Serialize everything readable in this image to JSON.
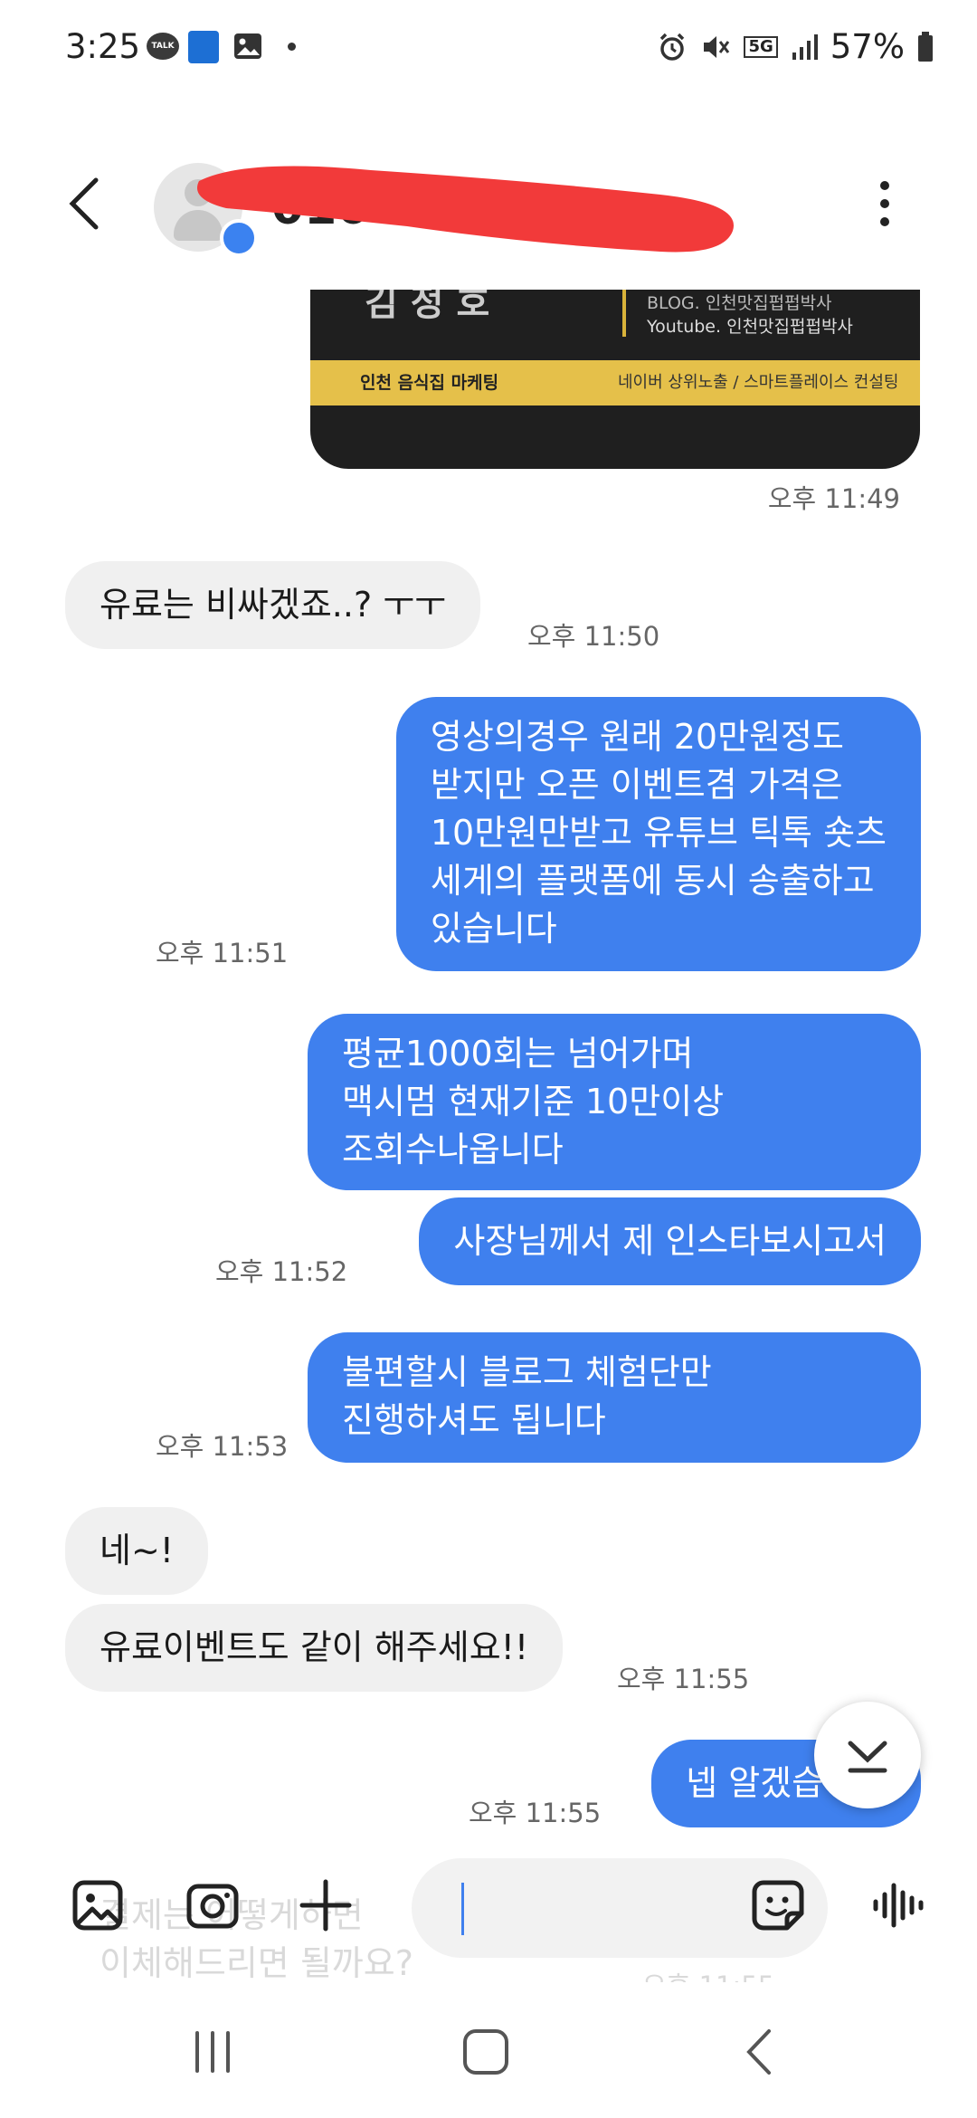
{
  "status_bar": {
    "time": "3:25",
    "talk_badge": "TALK",
    "network": "5G",
    "battery": "57%"
  },
  "header": {
    "contact_name": "010-",
    "back_label": "back",
    "more_label": "more options"
  },
  "image_card": {
    "top_text": "김 정 호",
    "blog_line": "BLOG. 인천맛집펍펍박사",
    "youtube_line": "Youtube. 인천맛집펍펍박사",
    "strip_left": "인천 음식집 마케팅",
    "strip_right": "네이버 상위노출 / 스마트플레이스 컨설팅"
  },
  "messages": [
    {
      "id": "ts0",
      "text": "오후 11:49"
    },
    {
      "id": "m1",
      "dir": "in",
      "lines": [
        "유료는 비싸겠죠..? ㅜㅜ"
      ],
      "time": "오후 11:50"
    },
    {
      "id": "m2",
      "dir": "out",
      "lines": [
        "영상의경우 원래 20만원정도",
        "받지만 오픈 이벤트겸 가격은",
        "10만원만받고 유튜브 틱톡 숏츠",
        "세게의 플랫폼에 동시 송출하고",
        "있습니다"
      ],
      "time": "오후 11:51"
    },
    {
      "id": "m3",
      "dir": "out",
      "lines": [
        "평균1000회는 넘어가며",
        "맥시멈 현재기준 10만이상",
        "조회수나옵니다"
      ]
    },
    {
      "id": "m4",
      "dir": "out",
      "lines": [
        "사장님께서 제 인스타보시고서"
      ],
      "time": "오후 11:52"
    },
    {
      "id": "m5",
      "dir": "out",
      "lines": [
        "불편할시 블로그 체험단만",
        "진행하셔도 됩니다"
      ],
      "time": "오후 11:53"
    },
    {
      "id": "m6",
      "dir": "in",
      "lines": [
        "네~!"
      ]
    },
    {
      "id": "m7",
      "dir": "in",
      "lines": [
        "유료이벤트도 같이 해주세요!!"
      ],
      "time": "오후 11:55"
    },
    {
      "id": "m8",
      "dir": "out",
      "lines": [
        "넵 알겠습니다"
      ],
      "time": "오후 11:55"
    }
  ],
  "faded_message": {
    "line1": "결제는 어떻게하면",
    "line2": "이체해드리면 될까요?",
    "time": "오후 11:55"
  },
  "composer": {
    "gallery_icon": "gallery-icon",
    "camera_icon": "camera-icon",
    "plus_icon": "plus-icon",
    "emoji_icon": "emoji-sticker-icon",
    "voice_icon": "voice-record-icon"
  }
}
